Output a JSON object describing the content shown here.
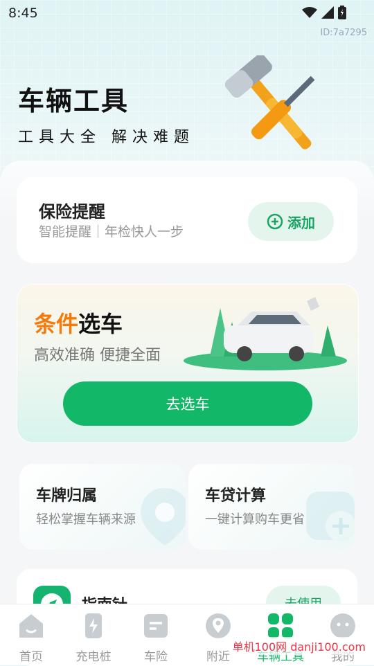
{
  "status": {
    "time": "8:45",
    "page_id": "ID:7a7295"
  },
  "hero": {
    "title": "车辆工具",
    "subtitle": "工具大全 解决难题"
  },
  "insurance": {
    "title": "保险提醒",
    "subtitle": "智能提醒｜年检快人一步",
    "add_label": "添加"
  },
  "select_car": {
    "title_highlight": "条件",
    "title_rest": "选车",
    "subtitle": "高效准确 便捷全面",
    "button_label": "去选车"
  },
  "tools": [
    {
      "title": "车牌归属",
      "subtitle": "轻松掌握车辆来源"
    },
    {
      "title": "车贷计算",
      "subtitle": "一键计算购车更省"
    }
  ],
  "guide": {
    "title": "指南针",
    "button_label": "去使用"
  },
  "tabs": [
    {
      "label": "首页"
    },
    {
      "label": "充电桩"
    },
    {
      "label": "车险"
    },
    {
      "label": "附近"
    },
    {
      "label": "车辆工具"
    },
    {
      "label": "我的"
    }
  ],
  "watermark": "单机100网 danji100.com",
  "colors": {
    "accent": "#12b767",
    "orange": "#f47a0b"
  }
}
